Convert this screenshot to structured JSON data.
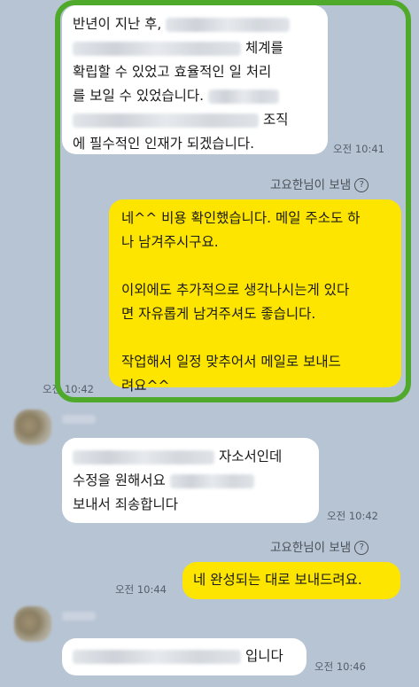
{
  "messages": {
    "m1": {
      "line1_a": "반년이 지난 후,",
      "line2_b": "체계를",
      "line3": "확립할 수 있었고 효율적인 일 처리",
      "line4": "를 보일 수 있었습니다.",
      "line5_b": "조직",
      "line6": "에 필수적인 인재가 되겠습니다.",
      "time": "오전 10:41"
    },
    "m2": {
      "sender": "고요한님이 보냄",
      "para1_l1": "네^^ 비용 확인했습니다. 메일 주소도 하",
      "para1_l2": "나 남겨주시구요.",
      "para2_l1": "이외에도 추가적으로 생각나시는게 있다",
      "para2_l2": "면 자유롭게 남겨주셔도 좋습니다.",
      "para3_l1": "작업해서 일정 맞추어서 메일로 보내드",
      "para3_l2": "려요^^",
      "time": "오전 10:42"
    },
    "m3": {
      "line1_b": "자소서인데",
      "line2_a": "수정을 원해서요",
      "line3": "보내서 죄송합니다",
      "time": "오전 10:42"
    },
    "m4": {
      "sender": "고요한님이 보냄",
      "text": "네 완성되는 대로 보내드려요.",
      "time": "오전 10:44"
    },
    "m5": {
      "text_b": "입니다",
      "time": "오전 10:46"
    }
  },
  "icons": {
    "help": "?"
  },
  "colors": {
    "background": "#b7c4d3",
    "my_bubble": "#fee500",
    "their_bubble": "#ffffff",
    "highlight": "#4faa2c"
  }
}
